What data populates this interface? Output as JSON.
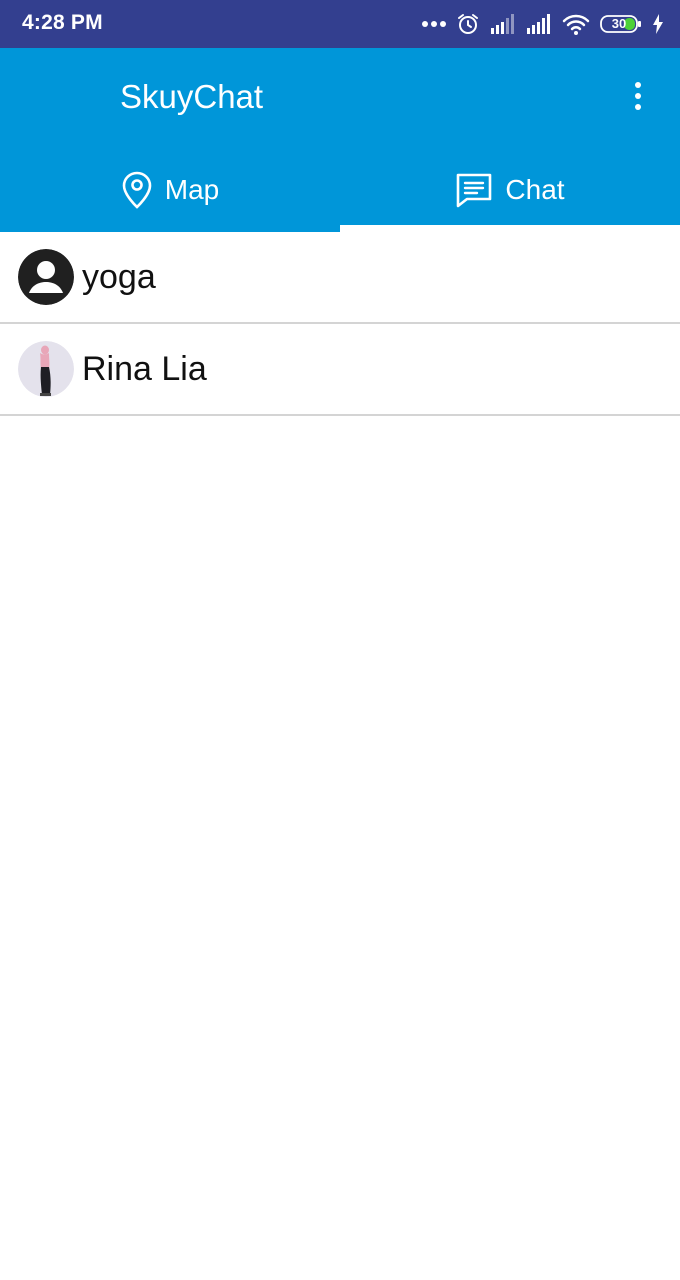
{
  "status_bar": {
    "time": "4:28 PM",
    "battery": "30",
    "icons": [
      "more-dots-icon",
      "alarm-icon",
      "signal-icon",
      "signal-icon",
      "wifi-icon",
      "battery-icon",
      "charging-icon"
    ]
  },
  "app_bar": {
    "title": "SkuyChat",
    "overflow_icon": "more-vert-icon"
  },
  "tabs": [
    {
      "label": "Map",
      "icon": "map-pin-icon",
      "selected": false
    },
    {
      "label": "Chat",
      "icon": "chat-bubble-icon",
      "selected": true
    }
  ],
  "chats": [
    {
      "name": "yoga",
      "avatar": "default-person-avatar"
    },
    {
      "name": "Rina Lia",
      "avatar": "profile-photo"
    }
  ],
  "colors": {
    "status_bar": "#333f8f",
    "primary": "#0096d9",
    "text_on_primary": "#ffffff",
    "divider": "#d4d4d4"
  }
}
